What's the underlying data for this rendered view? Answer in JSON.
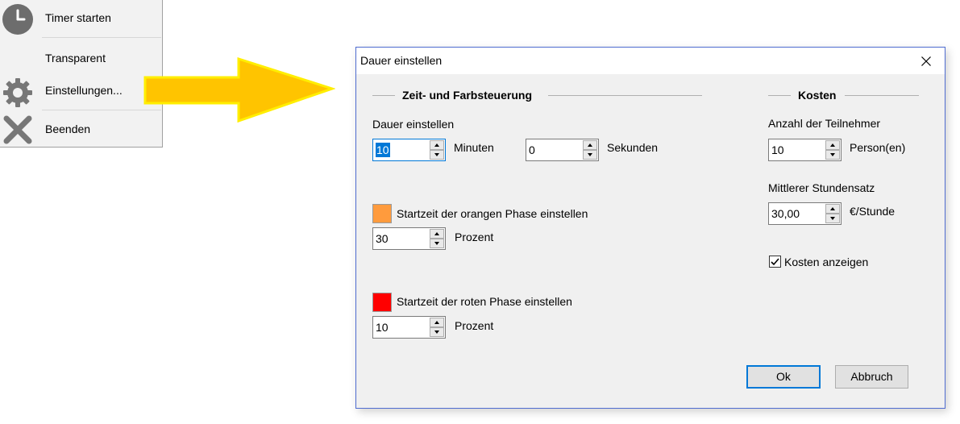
{
  "context_menu": {
    "items": [
      {
        "label": "Timer starten",
        "icon": "clock-icon"
      },
      {
        "label": "Transparent",
        "icon": ""
      },
      {
        "label": "Einstellungen...",
        "icon": "gear-icon"
      },
      {
        "label": "Beenden",
        "icon": "close-x-icon"
      }
    ]
  },
  "arrow": {
    "color": "#ffc400",
    "outline": "#ffee00"
  },
  "dialog": {
    "title": "Dauer einstellen",
    "time_group": {
      "title": "Zeit- und Farbsteuerung",
      "duration_label": "Dauer einstellen",
      "minutes_value": "10",
      "minutes_label": "Minuten",
      "seconds_value": "0",
      "seconds_label": "Sekunden",
      "orange_color": "#ff9b3d",
      "orange_label": "Startzeit der orangen Phase einstellen",
      "orange_value": "30",
      "orange_unit": "Prozent",
      "red_color": "#ff0000",
      "red_label": "Startzeit der roten Phase einstellen",
      "red_value": "10",
      "red_unit": "Prozent"
    },
    "cost_group": {
      "title": "Kosten",
      "participants_label": "Anzahl der Teilnehmer",
      "participants_value": "10",
      "participants_unit": "Person(en)",
      "rate_label": "Mittlerer Stundensatz",
      "rate_value": "30,00",
      "rate_unit": "€/Stunde",
      "show_costs_label": "Kosten anzeigen",
      "show_costs_checked": true
    },
    "ok_label": "Ok",
    "cancel_label": "Abbruch"
  }
}
